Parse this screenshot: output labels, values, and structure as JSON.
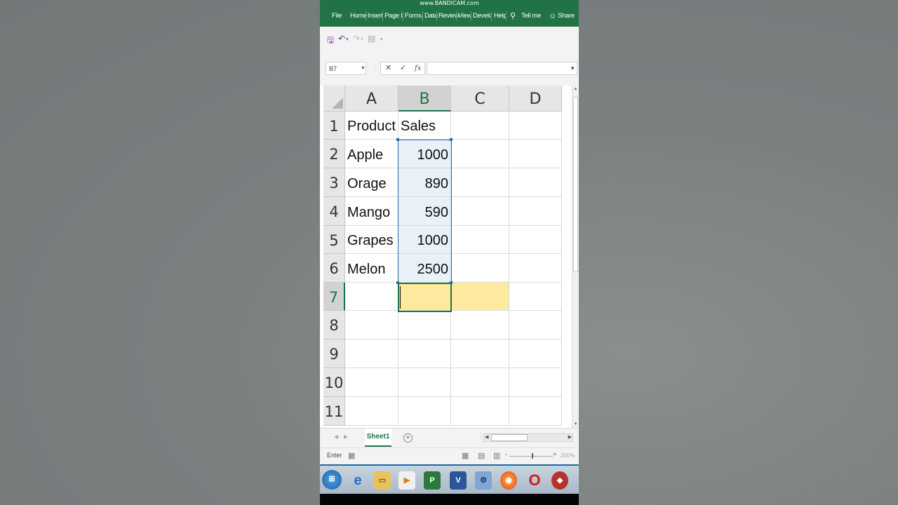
{
  "watermark": "www.BANDICAM.com",
  "ribbon": {
    "tabs": [
      "File",
      "Home",
      "Insert",
      "Page La",
      "Formul",
      "Data",
      "Review",
      "View",
      "Develo",
      "Help"
    ],
    "tell_me": "Tell me",
    "share": "Share"
  },
  "formula_bar": {
    "name_box": "B7",
    "cancel": "✕",
    "enter": "✓",
    "fx": "fx",
    "value": ""
  },
  "grid": {
    "columns": [
      "A",
      "B",
      "C",
      "D"
    ],
    "selected_column": "B",
    "rows": [
      {
        "num": "1",
        "a": "Product",
        "b": "Sales"
      },
      {
        "num": "2",
        "a": "Apple",
        "b": "1000"
      },
      {
        "num": "3",
        "a": "Orage",
        "b": "890"
      },
      {
        "num": "4",
        "a": "Mango",
        "b": "590"
      },
      {
        "num": "5",
        "a": "Grapes",
        "b": "1000"
      },
      {
        "num": "6",
        "a": "Melon",
        "b": "2500"
      },
      {
        "num": "7",
        "a": "",
        "b": ""
      },
      {
        "num": "8",
        "a": "",
        "b": ""
      },
      {
        "num": "9",
        "a": "",
        "b": ""
      },
      {
        "num": "10",
        "a": "",
        "b": ""
      },
      {
        "num": "11",
        "a": "",
        "b": ""
      }
    ],
    "active_cell": "B7",
    "selected_range": "B2:B6"
  },
  "sheet_tabs": [
    "Sheet1"
  ],
  "status": {
    "mode": "Enter",
    "zoom": "200%"
  },
  "colors": {
    "ribbon_green": "#217346",
    "range_fill": "#e8f0f8",
    "highlight": "#fde9a0"
  }
}
